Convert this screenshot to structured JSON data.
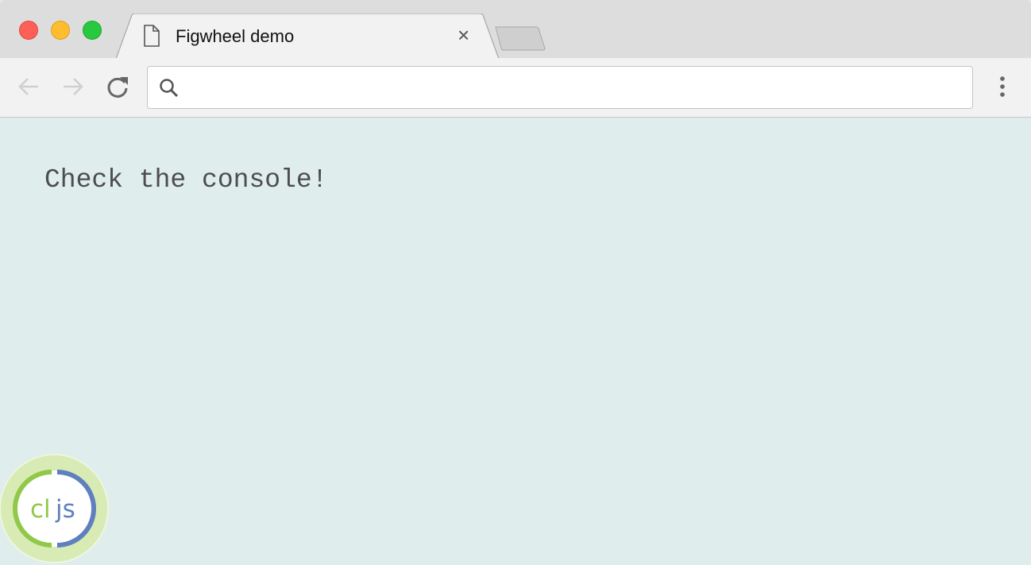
{
  "window": {
    "controls": {
      "close": "#fe5f57",
      "minimize": "#febc2e",
      "maximize": "#28c840"
    }
  },
  "tab": {
    "title": "Figwheel demo",
    "close_label": "×",
    "icon": "file-icon"
  },
  "toolbar": {
    "address_value": "",
    "address_placeholder": ""
  },
  "page": {
    "message": "Check the console!",
    "background": "#dfeded"
  },
  "badge": {
    "text": "cljs",
    "green": "#91c84a",
    "blue": "#5f7fbf"
  }
}
